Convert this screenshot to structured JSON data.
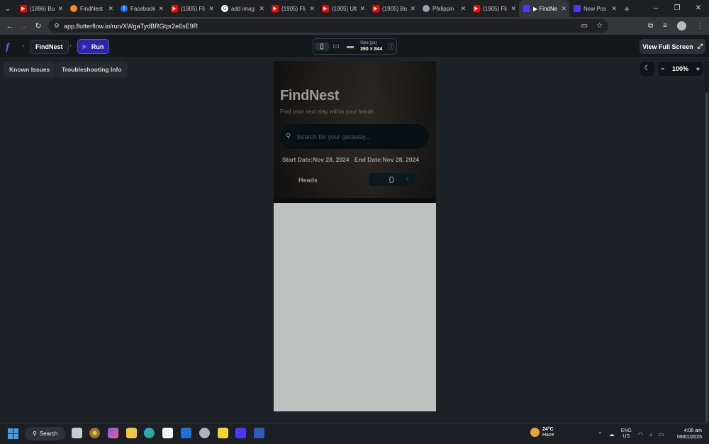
{
  "browser": {
    "tabs": [
      {
        "title": "(1896) Bu",
        "icon": "youtube-icon"
      },
      {
        "title": "FindNest",
        "icon": "flutterflow-fire-icon"
      },
      {
        "title": "Facebook",
        "icon": "facebook-icon"
      },
      {
        "title": "(1905) Fli",
        "icon": "youtube-icon"
      },
      {
        "title": "add imag",
        "icon": "google-icon"
      },
      {
        "title": "(1905) Fli",
        "icon": "youtube-icon"
      },
      {
        "title": "(1905) Ult",
        "icon": "youtube-icon"
      },
      {
        "title": "(1905) Bu",
        "icon": "youtube-icon"
      },
      {
        "title": "Philippin",
        "icon": "globe-icon"
      },
      {
        "title": "(1905) Fli",
        "icon": "youtube-icon"
      },
      {
        "title": "▶ FindNe",
        "icon": "flutterflow-icon"
      },
      {
        "title": "New Pos",
        "icon": "flutterflow-icon"
      }
    ],
    "url": "app.flutterflow.io/run/XWgaTydBRGtpr2e6sE9R"
  },
  "toolbar": {
    "project_name": "FindNest",
    "run_label": "Run",
    "size_label": "Size (px)",
    "size_value": "390 × 844",
    "fullscreen_label": "View Full Screen"
  },
  "canvas": {
    "known_issues_label": "Known Issues",
    "troubleshooting_label": "Troubleshooting Info",
    "zoom_value": "100%"
  },
  "app": {
    "title": "FindNest",
    "subtitle": "Find your next stay within your hands",
    "search_placeholder": "Search for your getaway...",
    "start_date": "Start Date:Nov 28, 2024",
    "end_date": "End Date:Nov 28, 2024",
    "heads_label": "Heads",
    "heads_count": "0"
  },
  "taskbar": {
    "search_label": "Search",
    "temperature": "24°C",
    "weather": "Haze",
    "lang_1": "ENG",
    "lang_2": "US",
    "time": "4:06 am",
    "date": "09/01/2025"
  },
  "colors": {
    "accent": "#4b39ef",
    "run_button": "#2e25a8",
    "canvas_bg": "#1e2227",
    "phone_bg": "#bfc1c0"
  }
}
